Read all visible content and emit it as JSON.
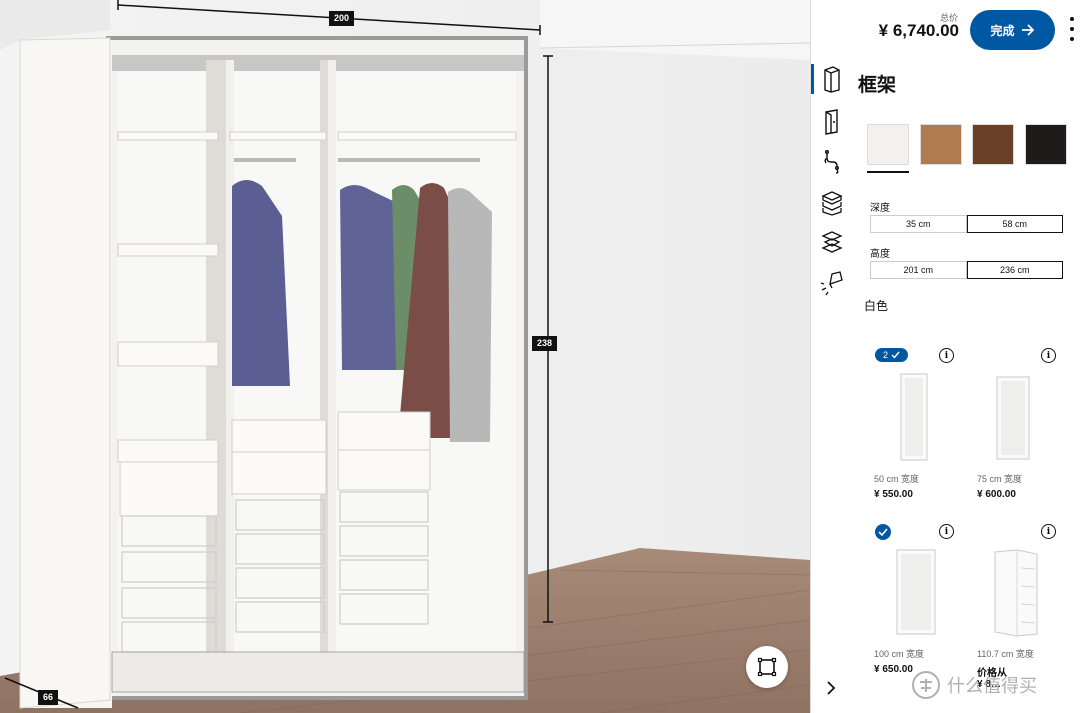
{
  "viewport": {
    "dim_width": "200",
    "dim_height": "238",
    "dim_depth": "66",
    "fit_icon": "frame-fit-icon"
  },
  "header": {
    "total_caption": "总价",
    "total_price": "¥ 6,740.00",
    "done_label": "完成"
  },
  "categories": [
    {
      "name": "frame",
      "icon": "wardrobe-frame-icon",
      "active": true
    },
    {
      "name": "doors",
      "icon": "door-icon",
      "active": false
    },
    {
      "name": "fittings",
      "icon": "hanger-hook-icon",
      "active": false
    },
    {
      "name": "interior",
      "icon": "stack-boxes-icon",
      "active": false
    },
    {
      "name": "drawers",
      "icon": "basket-icon",
      "active": false
    },
    {
      "name": "lighting",
      "icon": "lamp-icon",
      "active": false
    }
  ],
  "section_title": "框架",
  "swatches": [
    {
      "name": "white",
      "color": "#f2f1ed",
      "selected": true
    },
    {
      "name": "oak",
      "color": "#b07c4f",
      "selected": false
    },
    {
      "name": "walnut",
      "color": "#6a4028",
      "selected": false
    },
    {
      "name": "black",
      "color": "#1f1b1a",
      "selected": false
    }
  ],
  "depth": {
    "label": "深度",
    "options": [
      "35 cm",
      "58 cm"
    ],
    "selected": 1
  },
  "height": {
    "label": "高度",
    "options": [
      "201 cm",
      "236 cm"
    ],
    "selected": 1
  },
  "color_name": "白色",
  "products": [
    {
      "qty": "2",
      "width_text": "50 cm 宽度",
      "price": "¥ 550.00",
      "state": "qty"
    },
    {
      "qty": "",
      "width_text": "75 cm 宽度",
      "price": "¥ 600.00",
      "state": "none"
    },
    {
      "qty": "",
      "width_text": "100 cm 宽度",
      "price": "¥ 650.00",
      "state": "check"
    },
    {
      "qty": "",
      "width_text": "110.7 cm 宽度",
      "price": "价格从",
      "price_partial": "¥ 8…",
      "state": "none"
    }
  ],
  "watermark": "什么值得买"
}
